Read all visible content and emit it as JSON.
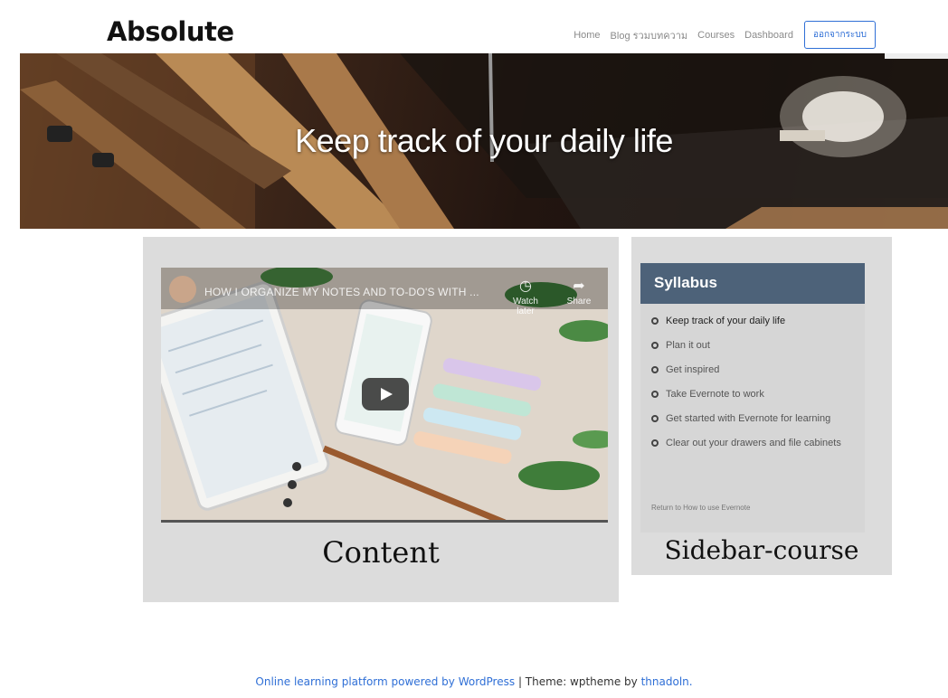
{
  "site": {
    "logo": "Absolute"
  },
  "nav": {
    "items": [
      "Home",
      "Blog รวมบทความ",
      "Courses",
      "Dashboard"
    ],
    "logout_label": "ออกจากระบบ"
  },
  "hero": {
    "title": "Keep track of your daily life"
  },
  "video": {
    "title": "HOW I ORGANIZE MY NOTES AND TO-DO'S WITH ...",
    "watch_later": "Watch later",
    "share": "Share"
  },
  "content": {
    "label": "Content"
  },
  "sidebar": {
    "heading": "Syllabus",
    "items": [
      "Keep track of your daily life",
      "Plan it out",
      "Get inspired",
      "Take Evernote to work",
      "Get started with Evernote for learning",
      "Clear out your drawers and file cabinets"
    ],
    "return_link": "Return to How to use Evernote",
    "label": "Sidebar-course"
  },
  "footer": {
    "platform_link": "Online learning platform powered by WordPress",
    "separator": " | Theme: wptheme by ",
    "author_link": "thnadoln."
  },
  "colors": {
    "accent": "#2f6fd6",
    "syllabus_header": "#4d6279",
    "panel_bg": "#dcdcdc"
  }
}
